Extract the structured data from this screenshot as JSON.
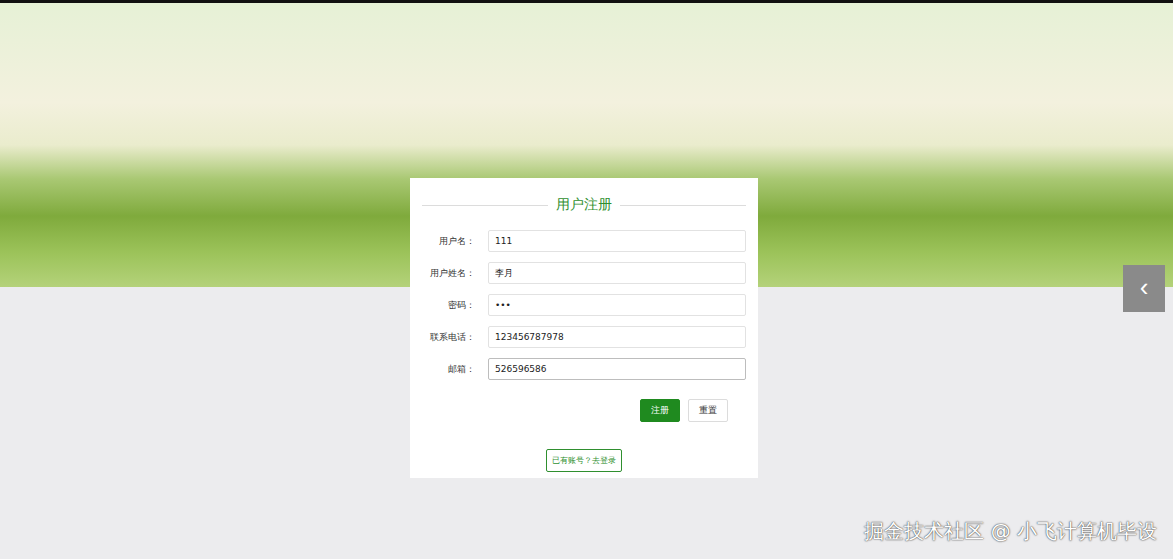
{
  "form": {
    "title": "用户注册",
    "fields": [
      {
        "label": "用户名：",
        "value": "111",
        "focused": false
      },
      {
        "label": "用户姓名：",
        "value": "李月",
        "focused": false
      },
      {
        "label": "密码：",
        "value": "•••",
        "focused": false
      },
      {
        "label": "联系电话：",
        "value": "123456787978",
        "focused": false
      },
      {
        "label": "邮箱：",
        "value": "526596586",
        "focused": true
      }
    ],
    "buttons": [
      {
        "label": "注册",
        "kind": "primary"
      },
      {
        "label": "重置",
        "kind": "plain"
      }
    ],
    "login_link": "已有账号？去登录"
  },
  "carousel": {
    "arrow": "‹"
  },
  "watermark": "掘金技术社区 @ 小飞计算机毕设"
}
